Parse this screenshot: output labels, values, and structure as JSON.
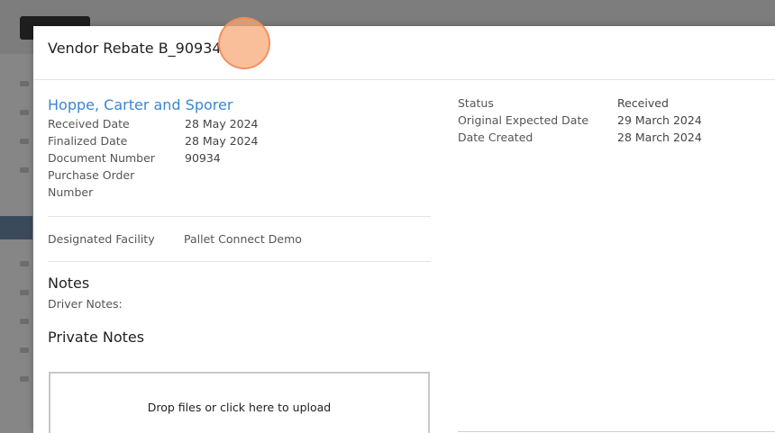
{
  "modal": {
    "title": "Vendor Rebate B_90934"
  },
  "vendor": {
    "name": "Hoppe, Carter and Sporer",
    "details": [
      {
        "label": "Received Date",
        "value": "28 May 2024"
      },
      {
        "label": "Finalized Date",
        "value": "28 May 2024"
      },
      {
        "label": "Document Number",
        "value": "90934"
      }
    ],
    "po_label_line1": "Purchase Order",
    "po_label_line2": "Number",
    "po_value": ""
  },
  "facility": {
    "label": "Designated Facility",
    "value": "Pallet Connect Demo"
  },
  "notes": {
    "title": "Notes",
    "driver_label": "Driver Notes:",
    "private_title": "Private Notes"
  },
  "upload": {
    "label": "Drop files or click here to upload"
  },
  "status": {
    "details": [
      {
        "label": "Status",
        "value": "Received"
      },
      {
        "label": "Original Expected Date",
        "value": "29 March 2024"
      },
      {
        "label": "Date Created",
        "value": "28 March 2024"
      }
    ]
  }
}
